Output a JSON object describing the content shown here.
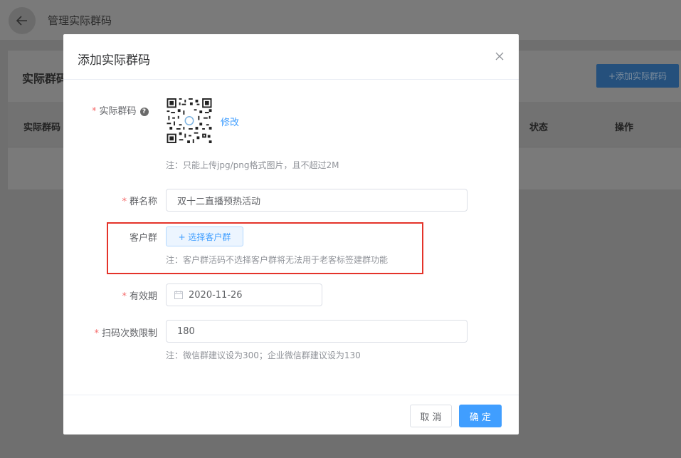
{
  "background": {
    "page_title": "管理实际群码",
    "card_title": "实际群码",
    "add_button": "+添加实际群码",
    "columns": [
      "实际群码",
      "状态",
      "操作"
    ]
  },
  "modal": {
    "title": "添加实际群码",
    "qr": {
      "label": "实际群码",
      "help": "?",
      "edit_link": "修改",
      "note": "注：只能上传jpg/png格式图片，且不超过2M"
    },
    "group_name": {
      "label": "群名称",
      "value": "双十二直播预热活动"
    },
    "customer_group": {
      "label": "客户群",
      "button": "+ 选择客户群",
      "note": "注：客户群活码不选择客户群将无法用于老客标签建群功能"
    },
    "validity": {
      "label": "有效期",
      "value": "2020-11-26"
    },
    "scan_limit": {
      "label": "扫码次数限制",
      "value": "180",
      "note": "注：微信群建议设为300；企业微信群建议设为130"
    },
    "buttons": {
      "cancel": "取 消",
      "ok": "确 定"
    }
  },
  "colors": {
    "primary": "#409eff",
    "required": "#f56c6c",
    "highlight": "#e4332a"
  }
}
